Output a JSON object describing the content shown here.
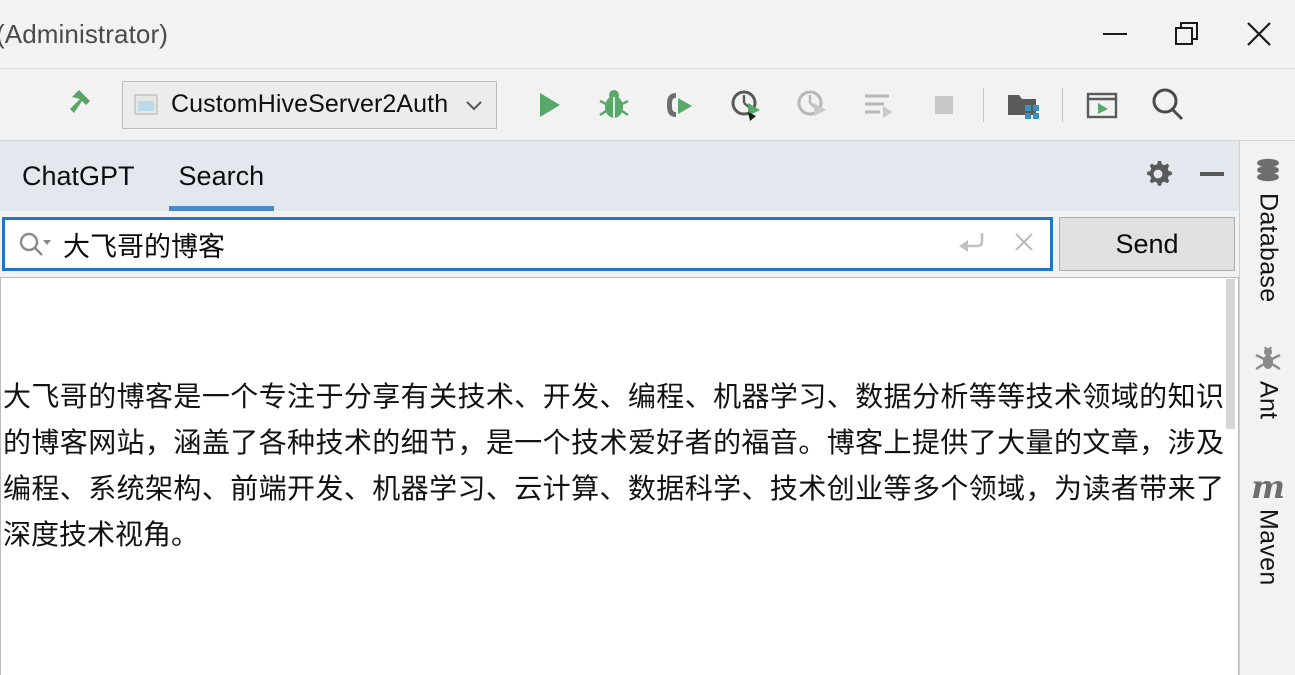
{
  "window": {
    "title": "(Administrator)",
    "controls": {
      "minimize": "minimize-icon",
      "restore": "restore-icon",
      "close": "close-icon"
    }
  },
  "toolbar": {
    "build_icon": "hammer-icon",
    "run_config": {
      "label": "CustomHiveServer2Auth",
      "icon": "application-icon",
      "caret": "chevron-down-icon"
    },
    "actions": [
      {
        "name": "run-icon",
        "enabled": true
      },
      {
        "name": "debug-icon",
        "enabled": true
      },
      {
        "name": "run-with-coverage-icon",
        "enabled": true
      },
      {
        "name": "profile-icon",
        "enabled": true
      },
      {
        "name": "profile-memory-icon",
        "enabled": false
      },
      {
        "name": "run-tests-icon",
        "enabled": false
      },
      {
        "name": "stop-icon",
        "enabled": false
      },
      {
        "name": "project-structure-icon",
        "enabled": true
      },
      {
        "name": "terminal-icon",
        "enabled": true
      },
      {
        "name": "search-everywhere-icon",
        "enabled": true
      }
    ]
  },
  "tool_window": {
    "tabs": [
      {
        "label": "ChatGPT",
        "active": false
      },
      {
        "label": "Search",
        "active": true
      }
    ],
    "actions": [
      {
        "name": "settings-gear-icon"
      },
      {
        "name": "hide-window-icon"
      }
    ],
    "accent_color": "#4a88c7"
  },
  "search": {
    "value": "大飞哥的博客",
    "placeholder": "",
    "magnifier_icon": "search-dropdown-icon",
    "enter_icon": "enter-arrow-icon",
    "clear_icon": "clear-x-icon",
    "send_label": "Send",
    "focus_border_color": "#2275cd"
  },
  "result": {
    "answer": "大飞哥的博客是一个专注于分享有关技术、开发、编程、机器学习、数据分析等等技术领域的知识的博客网站，涵盖了各种技术的细节，是一个技术爱好者的福音。博客上提供了大量的文章，涉及编程、系统架构、前端开发、机器学习、云计算、数据科学、技术创业等多个领域，为读者带来了深度技术视角。"
  },
  "right_sidebar": {
    "items": [
      {
        "label": "Database",
        "icon": "database-icon"
      },
      {
        "label": "Ant",
        "icon": "ant-icon"
      },
      {
        "label": "Maven",
        "icon": "maven-m-icon"
      }
    ]
  }
}
